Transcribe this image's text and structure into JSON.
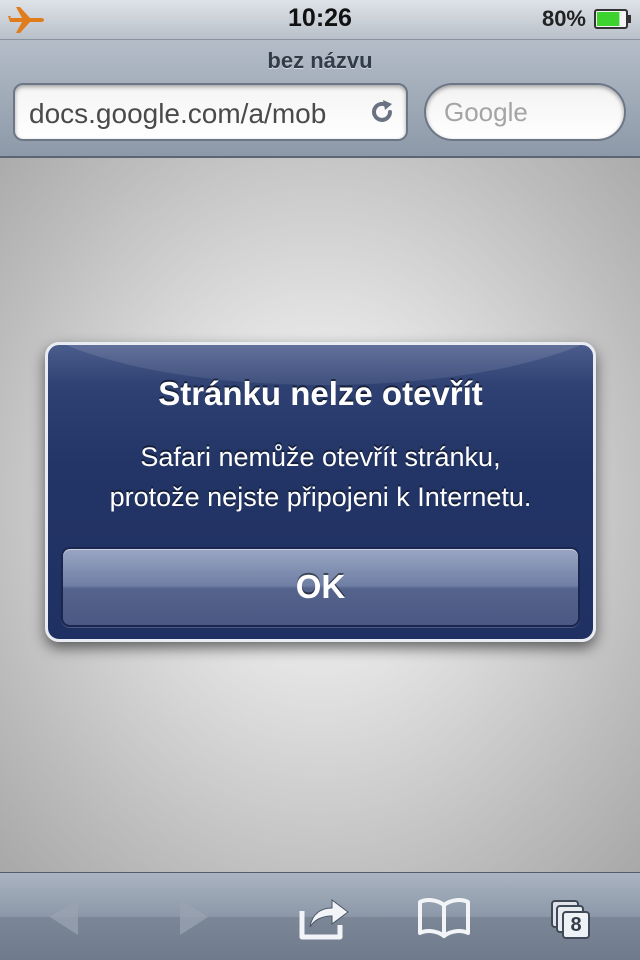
{
  "status_bar": {
    "time": "10:26",
    "battery_percent": "80%",
    "battery_level": 0.8,
    "airplane_mode_icon": "airplane-icon",
    "airplane_color": "#e07c1c",
    "battery_fill_color": "#3cd32f"
  },
  "browser": {
    "page_title": "bez názvu",
    "url": "docs.google.com/a/mob",
    "reload_icon": "reload-icon",
    "search_placeholder": "Google"
  },
  "alert": {
    "title": "Stránku nelze otevřít",
    "message_lines": [
      "Safari nemůže otevřít stránku,",
      "protože nejste připojeni k Internetu."
    ],
    "ok_label": "OK"
  },
  "toolbar": {
    "back_icon": "back-arrow-icon",
    "forward_icon": "forward-arrow-icon",
    "share_icon": "share-icon",
    "bookmarks_icon": "bookmarks-book-icon",
    "tabs_icon": "tabs-icon",
    "tabs_count": "8"
  }
}
